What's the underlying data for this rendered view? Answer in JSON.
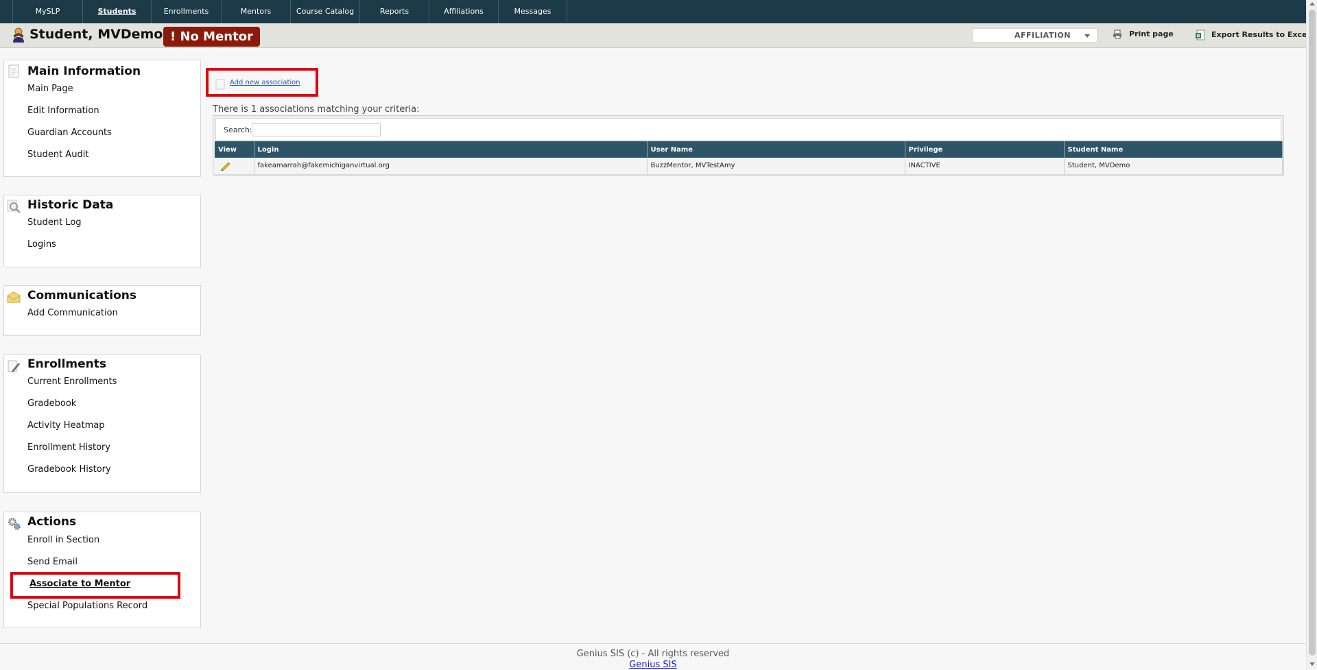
{
  "nav": {
    "tabs": [
      {
        "label": "MySLP",
        "active": false
      },
      {
        "label": "Students",
        "active": true
      },
      {
        "label": "Enrollments",
        "active": false
      },
      {
        "label": "Mentors",
        "active": false
      },
      {
        "label": "Course Catalog",
        "active": false
      },
      {
        "label": "Reports",
        "active": false
      },
      {
        "label": "Affiliations",
        "active": false
      },
      {
        "label": "Messages",
        "active": false
      }
    ]
  },
  "header": {
    "student_name": "Student, MVDemo",
    "mentor_badge": "! No Mentor",
    "affiliation_select": "AFFILIATION",
    "print_label": "Print page",
    "export_label": "Export Results to Excel"
  },
  "sidebar": {
    "main_info": {
      "title": "Main Information",
      "items": [
        "Main Page",
        "Edit Information",
        "Guardian Accounts",
        "Student Audit"
      ]
    },
    "historic": {
      "title": "Historic Data",
      "items": [
        "Student Log",
        "Logins"
      ]
    },
    "communications": {
      "title": "Communications",
      "items": [
        "Add Communication"
      ]
    },
    "enrollments": {
      "title": "Enrollments",
      "items": [
        "Current Enrollments",
        "Gradebook",
        "Activity Heatmap",
        "Enrollment History",
        "Gradebook History"
      ]
    },
    "actions": {
      "title": "Actions",
      "items": [
        "Enroll in Section",
        "Send Email",
        "Associate to Mentor",
        "Special Populations Record"
      ]
    }
  },
  "main": {
    "add_link": "Add new association",
    "match_text": "There is 1 associations matching your criteria:",
    "search_label": "Search:",
    "search_value": "",
    "columns": [
      "View",
      "Login",
      "User Name",
      "Privilege",
      "Student Name"
    ],
    "rows": [
      {
        "login": "fakeamarrah@fakemichiganvirtual.org",
        "user_name": "BuzzMentor, MVTestAmy",
        "privilege": "INACTIVE",
        "student_name": "Student, MVDemo"
      }
    ]
  },
  "footer": {
    "copyright": "Genius SIS (c) - All rights reserved",
    "link": "Genius SIS"
  },
  "colors": {
    "nav_bg": "#1c3a47",
    "table_header_bg": "#2e5567",
    "badge_bg": "#8b1a0b",
    "highlight_border": "#e0000f"
  }
}
